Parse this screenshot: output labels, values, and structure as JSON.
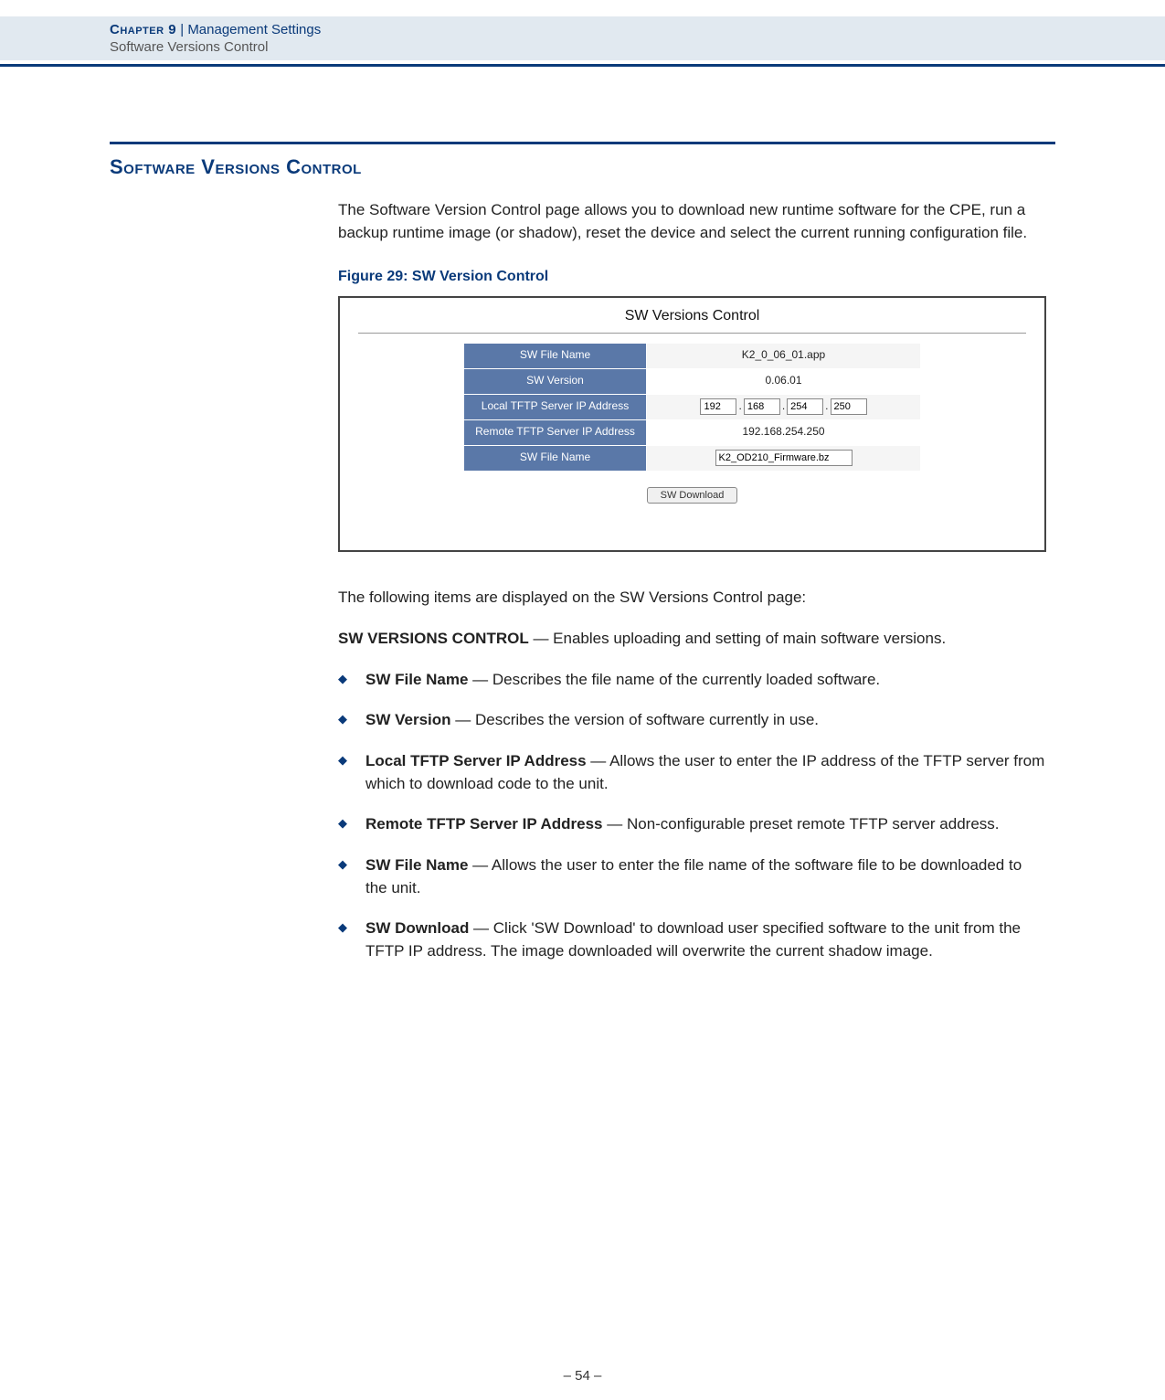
{
  "header": {
    "chapter_label": "Chapter 9",
    "separator": "  |  ",
    "chapter_title": "Management Settings",
    "subheading": "Software Versions Control"
  },
  "section": {
    "title": "Software Versions Control",
    "intro": "The Software Version Control page allows you to download new runtime software for the CPE, run a backup runtime image (or shadow), reset the device and select the current running configuration file."
  },
  "figure": {
    "caption": "Figure 29:  SW Version Control",
    "title": "SW Versions Control",
    "rows": {
      "r0_label": "SW File Name",
      "r0_value": "K2_0_06_01.app",
      "r1_label": "SW Version",
      "r1_value": "0.06.01",
      "r2_label": "Local TFTP Server IP Address",
      "r2_oct1": "192",
      "r2_oct2": "168",
      "r2_oct3": "254",
      "r2_oct4": "250",
      "r2_sep": ".",
      "r3_label": "Remote TFTP Server IP Address",
      "r3_value": "192.168.254.250",
      "r4_label": "SW File Name",
      "r4_value": "K2_OD210_Firmware.bz"
    },
    "button": "SW Download"
  },
  "description": {
    "lead": "The following items are displayed on the SW Versions Control page:",
    "group_title": "SW VERSIONS CONTROL",
    "group_text": " — Enables uploading and setting of main software versions.",
    "items": {
      "i0_term": "SW File Name",
      "i0_text": " — Describes the file name of the currently loaded software.",
      "i1_term": "SW Version",
      "i1_text": " — Describes the version of software currently in use.",
      "i2_term": "Local TFTP Server IP Address",
      "i2_text": " — Allows the user to enter the IP address of the TFTP server from which to download code to the unit.",
      "i3_term": "Remote TFTP Server IP Address",
      "i3_text": " — Non-configurable preset remote TFTP server address.",
      "i4_term": "SW File Name",
      "i4_text": " — Allows the user to enter the file name of the software file to be downloaded to the unit.",
      "i5_term": "SW Download",
      "i5_text": " — Click 'SW Download' to download user specified software to the unit from the TFTP IP address. The image downloaded will overwrite the current shadow image."
    }
  },
  "footer": {
    "page": "–  54  –"
  }
}
